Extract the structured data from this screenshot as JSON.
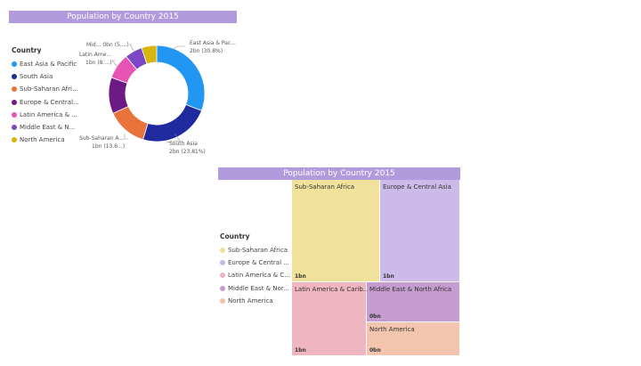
{
  "donut": {
    "title": "Population by Country 2015",
    "legend_title": "Country",
    "legend": [
      {
        "label": "East Asia & Pacific",
        "color": "#2196f3"
      },
      {
        "label": "South Asia",
        "color": "#1e2a9e"
      },
      {
        "label": "Sub-Saharan Afri...",
        "color": "#e8743b"
      },
      {
        "label": "Europe & Central...",
        "color": "#6b1b83"
      },
      {
        "label": "Latin America & ...",
        "color": "#e754b4"
      },
      {
        "label": "Middle East & N...",
        "color": "#7b47c4"
      },
      {
        "label": "North America",
        "color": "#d8b40e"
      }
    ],
    "callouts": {
      "east_asia": [
        "East Asia & Pac...",
        "2bn (30.8%)"
      ],
      "south_asia": [
        "South Asia",
        "2bn (23.81%)"
      ],
      "sub_saharan": [
        "Sub-Saharan A...",
        "1bn (13.6...)"
      ],
      "latin_america": [
        "Latin Ame...",
        "1bn (8....)"
      ],
      "middle_east": [
        "Mid... 0bn (5....)"
      ]
    }
  },
  "chart_data": [
    {
      "type": "pie",
      "title": "Population by Country 2015",
      "legend_title": "Country",
      "categories": [
        "East Asia & Pacific",
        "South Asia",
        "Sub-Saharan Africa",
        "Europe & Central Asia",
        "Latin America & Caribbean",
        "Middle East & North Africa",
        "North America"
      ],
      "values": [
        30.8,
        23.81,
        13.6,
        12.2,
        8.6,
        5.9,
        5.09
      ],
      "colors": [
        "#2196f3",
        "#1e2a9e",
        "#e8743b",
        "#6b1b83",
        "#e754b4",
        "#7b47c4",
        "#d8b40e"
      ],
      "donut": true
    },
    {
      "type": "treemap",
      "title": "Population by Country 2015",
      "legend_title": "Country",
      "categories": [
        "Sub-Saharan Africa",
        "Europe & Central Asia",
        "Latin America & Caribbean",
        "Middle East & North Africa",
        "North America"
      ],
      "value_labels": [
        "1bn",
        "1bn",
        "1bn",
        "0bn",
        "0bn"
      ]
    }
  ],
  "treemap": {
    "title": "Population by Country 2015",
    "legend_title": "Country",
    "legend": [
      {
        "label": "Sub-Saharan Africa",
        "color": "#efe09a"
      },
      {
        "label": "Europe & Central ...",
        "color": "#c9b7e6"
      },
      {
        "label": "Latin America & C...",
        "color": "#efb4bf"
      },
      {
        "label": "Middle East & Nor...",
        "color": "#c39bcf"
      },
      {
        "label": "North America",
        "color": "#f2c3ad"
      }
    ],
    "tiles": [
      {
        "label": "Sub-Saharan Africa",
        "value": "1bn",
        "color": "#f1e19b"
      },
      {
        "label": "Europe & Central Asia",
        "value": "1bn",
        "color": "#ccbbe8"
      },
      {
        "label": "Latin America & Carib...",
        "value": "1bn",
        "color": "#efb5c0"
      },
      {
        "label": "Middle East & North Africa",
        "value": "0bn",
        "color": "#c49ccf"
      },
      {
        "label": "North America",
        "value": "0bn",
        "color": "#f3c4ae"
      }
    ]
  }
}
